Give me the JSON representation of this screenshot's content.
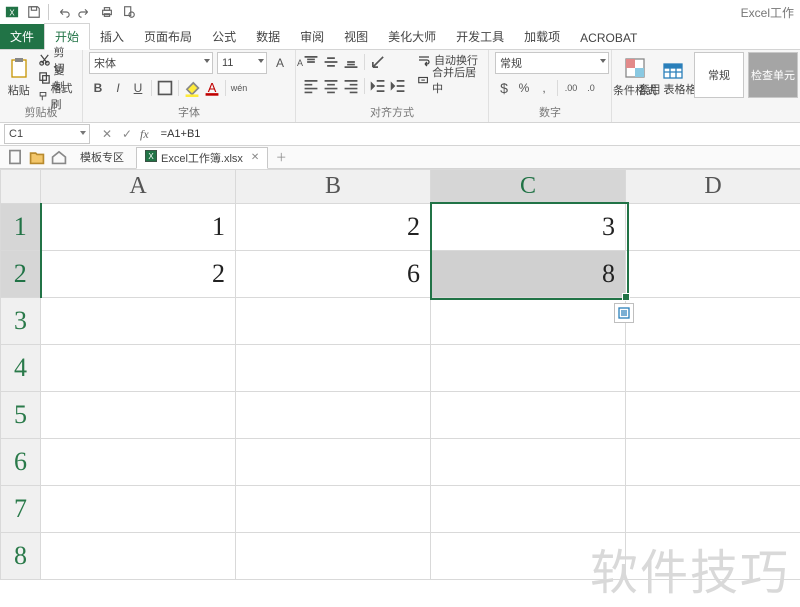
{
  "app_title": "Excel工作",
  "qat_icons": [
    "excel-icon",
    "save-icon",
    "undo-icon",
    "redo-icon",
    "print-icon",
    "preview-icon"
  ],
  "tabs": {
    "file": "文件",
    "items": [
      "开始",
      "插入",
      "页面布局",
      "公式",
      "数据",
      "审阅",
      "视图",
      "美化大师",
      "开发工具",
      "加载项",
      "ACROBAT"
    ],
    "active": "开始"
  },
  "ribbon": {
    "clipboard": {
      "paste": "粘贴",
      "cut": "剪切",
      "copy": "复制",
      "format_painter": "格式刷",
      "label": "剪贴板"
    },
    "font": {
      "name": "宋体",
      "size": "11",
      "label": "字体"
    },
    "align": {
      "wrap": "自动换行",
      "merge": "合并后居中",
      "label": "对齐方式"
    },
    "number": {
      "format": "常规",
      "label": "数字"
    },
    "styles": {
      "cond": "条件格式",
      "table": "套用\n表格格式",
      "normal": "常规",
      "check": "检查单元"
    }
  },
  "formula_bar": {
    "name_box": "C1",
    "formula": "=A1+B1"
  },
  "sheet_tabs": {
    "template": "模板专区",
    "file": "Excel工作簿.xlsx"
  },
  "chart_data": {
    "type": "table",
    "columns": [
      "A",
      "B",
      "C",
      "D"
    ],
    "rows_shown": 8,
    "cells": {
      "A1": 1,
      "B1": 2,
      "C1": 3,
      "A2": 2,
      "B2": 6,
      "C2": 8
    },
    "selection": "C1:C2",
    "active_cell": "C1"
  },
  "watermark": "软件技巧"
}
